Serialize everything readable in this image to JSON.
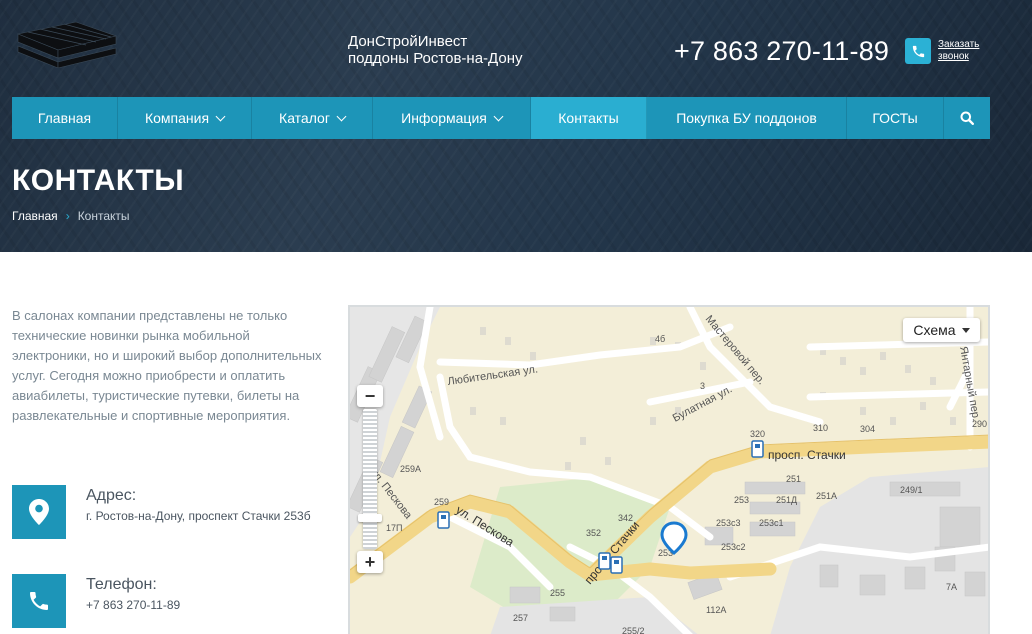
{
  "header": {
    "brand_line1": "ДонСтройИнвест",
    "brand_line2": "поддоны Ростов-на-Дону",
    "phone": "+7 863 270-11-89",
    "callback_line1": "Заказать",
    "callback_line2": "звонок",
    "logo_icon": "pallet-logo-icon"
  },
  "nav": {
    "items": [
      {
        "label": "Главная",
        "dropdown": false
      },
      {
        "label": "Компания",
        "dropdown": true
      },
      {
        "label": "Каталог",
        "dropdown": true
      },
      {
        "label": "Информация",
        "dropdown": true
      },
      {
        "label": "Контакты",
        "dropdown": false,
        "active": true
      },
      {
        "label": "Покупка БУ поддонов",
        "dropdown": false
      },
      {
        "label": "ГОСТы",
        "dropdown": false
      }
    ],
    "search_icon": "search-icon"
  },
  "page": {
    "title": "КОНТАКТЫ",
    "breadcrumb": [
      "Главная",
      "Контакты"
    ]
  },
  "content": {
    "intro": "В салонах компании представлены не только технические новинки рынка мобильной электроники, но и широкий выбор дополнительных услуг. Сегодня можно приобрести и оплатить авиабилеты, туристические путевки, билеты на развлекательные и спортивные мероприятия.",
    "address": {
      "label": "Адрес:",
      "value": "г. Ростов-на-Дону, проспект Стачки 253б",
      "icon": "location-pin-icon"
    },
    "phone": {
      "label": "Телефон:",
      "value": "+7 863 270-11-89",
      "icon": "phone-icon"
    }
  },
  "map": {
    "type_label": "Схема",
    "zoom_in": "+",
    "zoom_out": "−",
    "streets": [
      "Любительская ул.",
      "Мастеровой пер.",
      "Булатная ул.",
      "просп. Стачки",
      "ул. Пескова",
      "ул. Пескова",
      "просп. Стачки",
      "Янтарный пер."
    ],
    "buildings": [
      "4б",
      "3",
      "320",
      "310",
      "304",
      "290",
      "259А",
      "259",
      "17П",
      "342",
      "352",
      "251",
      "251Д",
      "251А",
      "249/1",
      "253",
      "253с3",
      "253с1",
      "253с2",
      "253",
      "255",
      "257",
      "255/2",
      "112А",
      "7А"
    ]
  },
  "colors": {
    "accent": "#1d95b8",
    "accent_active": "#2aaed1",
    "hero_bg": "#24364a"
  }
}
